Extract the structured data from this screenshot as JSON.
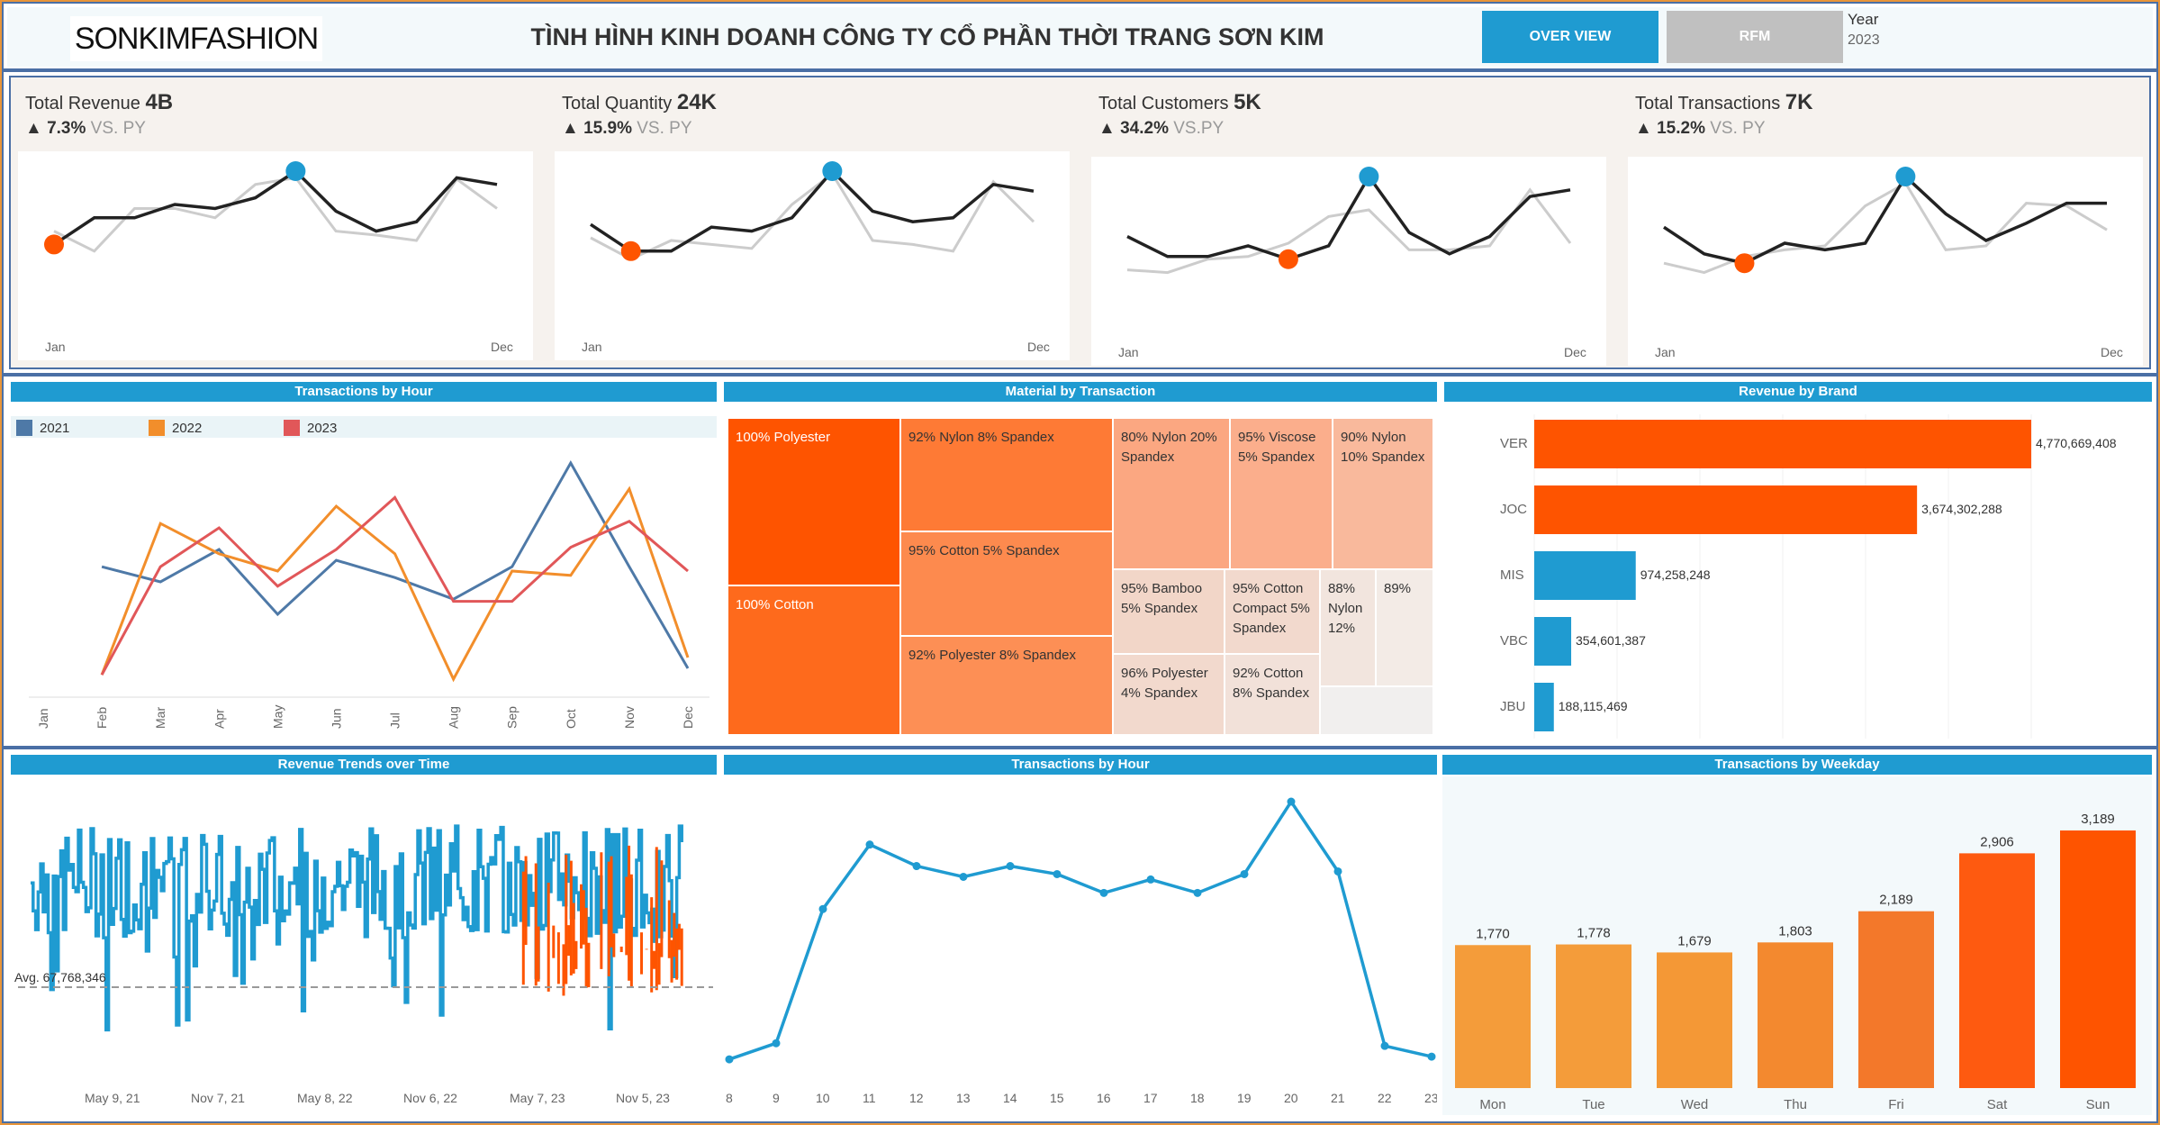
{
  "header": {
    "logo_text": "SONKIMFASHION",
    "title": "TÌNH HÌNH KINH DOANH CÔNG TY CỔ PHẦN THỜI TRANG SƠN KIM",
    "overview_btn": "OVER VIEW",
    "rfm_btn": "RFM",
    "year_label": "Year",
    "year_value": "2023"
  },
  "kpis": [
    {
      "label": "Total Revenue",
      "value": "4B",
      "change": "▲ 7.3%",
      "vs": "VS. PY",
      "x_start": "Jan",
      "x_end": "Dec",
      "cur": [
        0.55,
        0.35,
        0.35,
        0.25,
        0.28,
        0.2,
        0.0,
        0.3,
        0.45,
        0.38,
        0.05,
        0.1
      ],
      "prev": [
        0.45,
        0.6,
        0.28,
        0.28,
        0.35,
        0.1,
        0.05,
        0.45,
        0.48,
        0.52,
        0.06,
        0.28
      ]
    },
    {
      "label": "Total Quantity",
      "value": "24K",
      "change": "▲ 15.9%",
      "vs": "VS. PY",
      "x_start": "Jan",
      "x_end": "Dec",
      "cur": [
        0.4,
        0.6,
        0.6,
        0.42,
        0.45,
        0.35,
        0.0,
        0.3,
        0.38,
        0.35,
        0.1,
        0.15
      ],
      "prev": [
        0.5,
        0.66,
        0.52,
        0.55,
        0.58,
        0.25,
        0.02,
        0.52,
        0.55,
        0.6,
        0.08,
        0.38
      ]
    },
    {
      "label": "Total Customers",
      "value": "5K",
      "change": "▲ 34.2%",
      "vs": "VS.PY",
      "x_start": "Jan",
      "x_end": "Dec",
      "cur": [
        0.45,
        0.6,
        0.6,
        0.52,
        0.62,
        0.52,
        0.0,
        0.42,
        0.58,
        0.45,
        0.15,
        0.1
      ],
      "prev": [
        0.7,
        0.72,
        0.62,
        0.6,
        0.5,
        0.3,
        0.25,
        0.55,
        0.55,
        0.52,
        0.1,
        0.5
      ]
    },
    {
      "label": "Total Transactions",
      "value": "7K",
      "change": "▲ 15.2%",
      "vs": "VS. PY",
      "x_start": "Jan",
      "x_end": "Dec",
      "cur": [
        0.38,
        0.58,
        0.65,
        0.5,
        0.55,
        0.5,
        0.0,
        0.28,
        0.48,
        0.35,
        0.2,
        0.2
      ],
      "prev": [
        0.65,
        0.72,
        0.6,
        0.55,
        0.52,
        0.22,
        0.05,
        0.55,
        0.52,
        0.2,
        0.22,
        0.4
      ]
    }
  ],
  "panels": {
    "tx_by_hour_year_title": "Transactions by Hour",
    "material_title": "Material by Transaction",
    "brand_title": "Revenue by Brand",
    "rev_trend_title": "Revenue Trends over Time",
    "tx_by_hour_title": "Transactions by Hour",
    "weekday_title": "Transactions by Weekday"
  },
  "colors": {
    "accent": "#1f9bd1",
    "orange": "#fe5400",
    "series_2021": "#4e79a7",
    "series_2022": "#f28e2b",
    "series_2023": "#e15759"
  },
  "chart_data": [
    {
      "type": "line",
      "title": "Transactions by Hour",
      "categories": [
        "Jan",
        "Feb",
        "Mar",
        "Apr",
        "May",
        "Jun",
        "Jul",
        "Aug",
        "Sep",
        "Oct",
        "Nov",
        "Dec"
      ],
      "series": [
        {
          "name": "2021",
          "values": [
            null,
            0.52,
            0.45,
            0.6,
            0.3,
            0.55,
            0.47,
            0.37,
            0.52,
            1.0,
            0.52,
            0.05
          ]
        },
        {
          "name": "2022",
          "values": [
            null,
            0.02,
            0.72,
            0.58,
            0.5,
            0.8,
            0.58,
            0.0,
            0.5,
            0.48,
            0.88,
            0.1
          ]
        },
        {
          "name": "2023",
          "values": [
            null,
            0.02,
            0.52,
            0.7,
            0.43,
            0.6,
            0.84,
            0.36,
            0.36,
            0.61,
            0.73,
            0.5
          ]
        }
      ]
    },
    {
      "type": "table",
      "title": "Material by Transaction",
      "items": [
        "100% Polyester",
        "100% Cotton",
        "92% Nylon 8% Spandex",
        "95% Cotton 5% Spandex",
        "92% Polyester 8% Spandex",
        "80% Nylon 20% Spandex",
        "95% Viscose 5% Spandex",
        "90% Nylon 10% Spandex",
        "95% Bamboo 5% Spandex",
        "95% Cotton Compact 5% Spandex",
        "88% Nylon 12%",
        "89%",
        "96% Polyester 4% Spandex",
        "92% Cotton 8% Spandex"
      ]
    },
    {
      "type": "bar",
      "title": "Revenue by Brand",
      "categories": [
        "VER",
        "JOC",
        "MIS",
        "VBC",
        "JBU"
      ],
      "values": [
        4770669408,
        3674302288,
        974258248,
        354601387,
        188115469
      ],
      "labels": [
        "4,770,669,408",
        "3,674,302,288",
        "974,258,248",
        "354,601,387",
        "188,115,469"
      ]
    },
    {
      "type": "line",
      "title": "Revenue Trends over Time",
      "x_ticks": [
        "May 9, 21",
        "Nov 7, 21",
        "May 8, 22",
        "Nov 6, 22",
        "May 7, 23",
        "Nov 5, 23"
      ],
      "reference_line": "Avg. 67,768,346"
    },
    {
      "type": "line",
      "title": "Transactions by Hour",
      "categories": [
        "8",
        "9",
        "10",
        "11",
        "12",
        "13",
        "14",
        "15",
        "16",
        "17",
        "18",
        "19",
        "20",
        "21",
        "22",
        "23"
      ],
      "values": [
        0.04,
        0.1,
        0.6,
        0.84,
        0.76,
        0.72,
        0.76,
        0.73,
        0.66,
        0.71,
        0.66,
        0.73,
        1.0,
        0.74,
        0.09,
        0.05
      ]
    },
    {
      "type": "bar",
      "title": "Transactions by Weekday",
      "categories": [
        "Mon",
        "Tue",
        "Wed",
        "Thu",
        "Fri",
        "Sat",
        "Sun"
      ],
      "values": [
        1770,
        1778,
        1679,
        1803,
        2189,
        2906,
        3189
      ],
      "labels": [
        "1,770",
        "1,778",
        "1,679",
        "1,803",
        "2,189",
        "2,906",
        "3,189"
      ]
    }
  ]
}
